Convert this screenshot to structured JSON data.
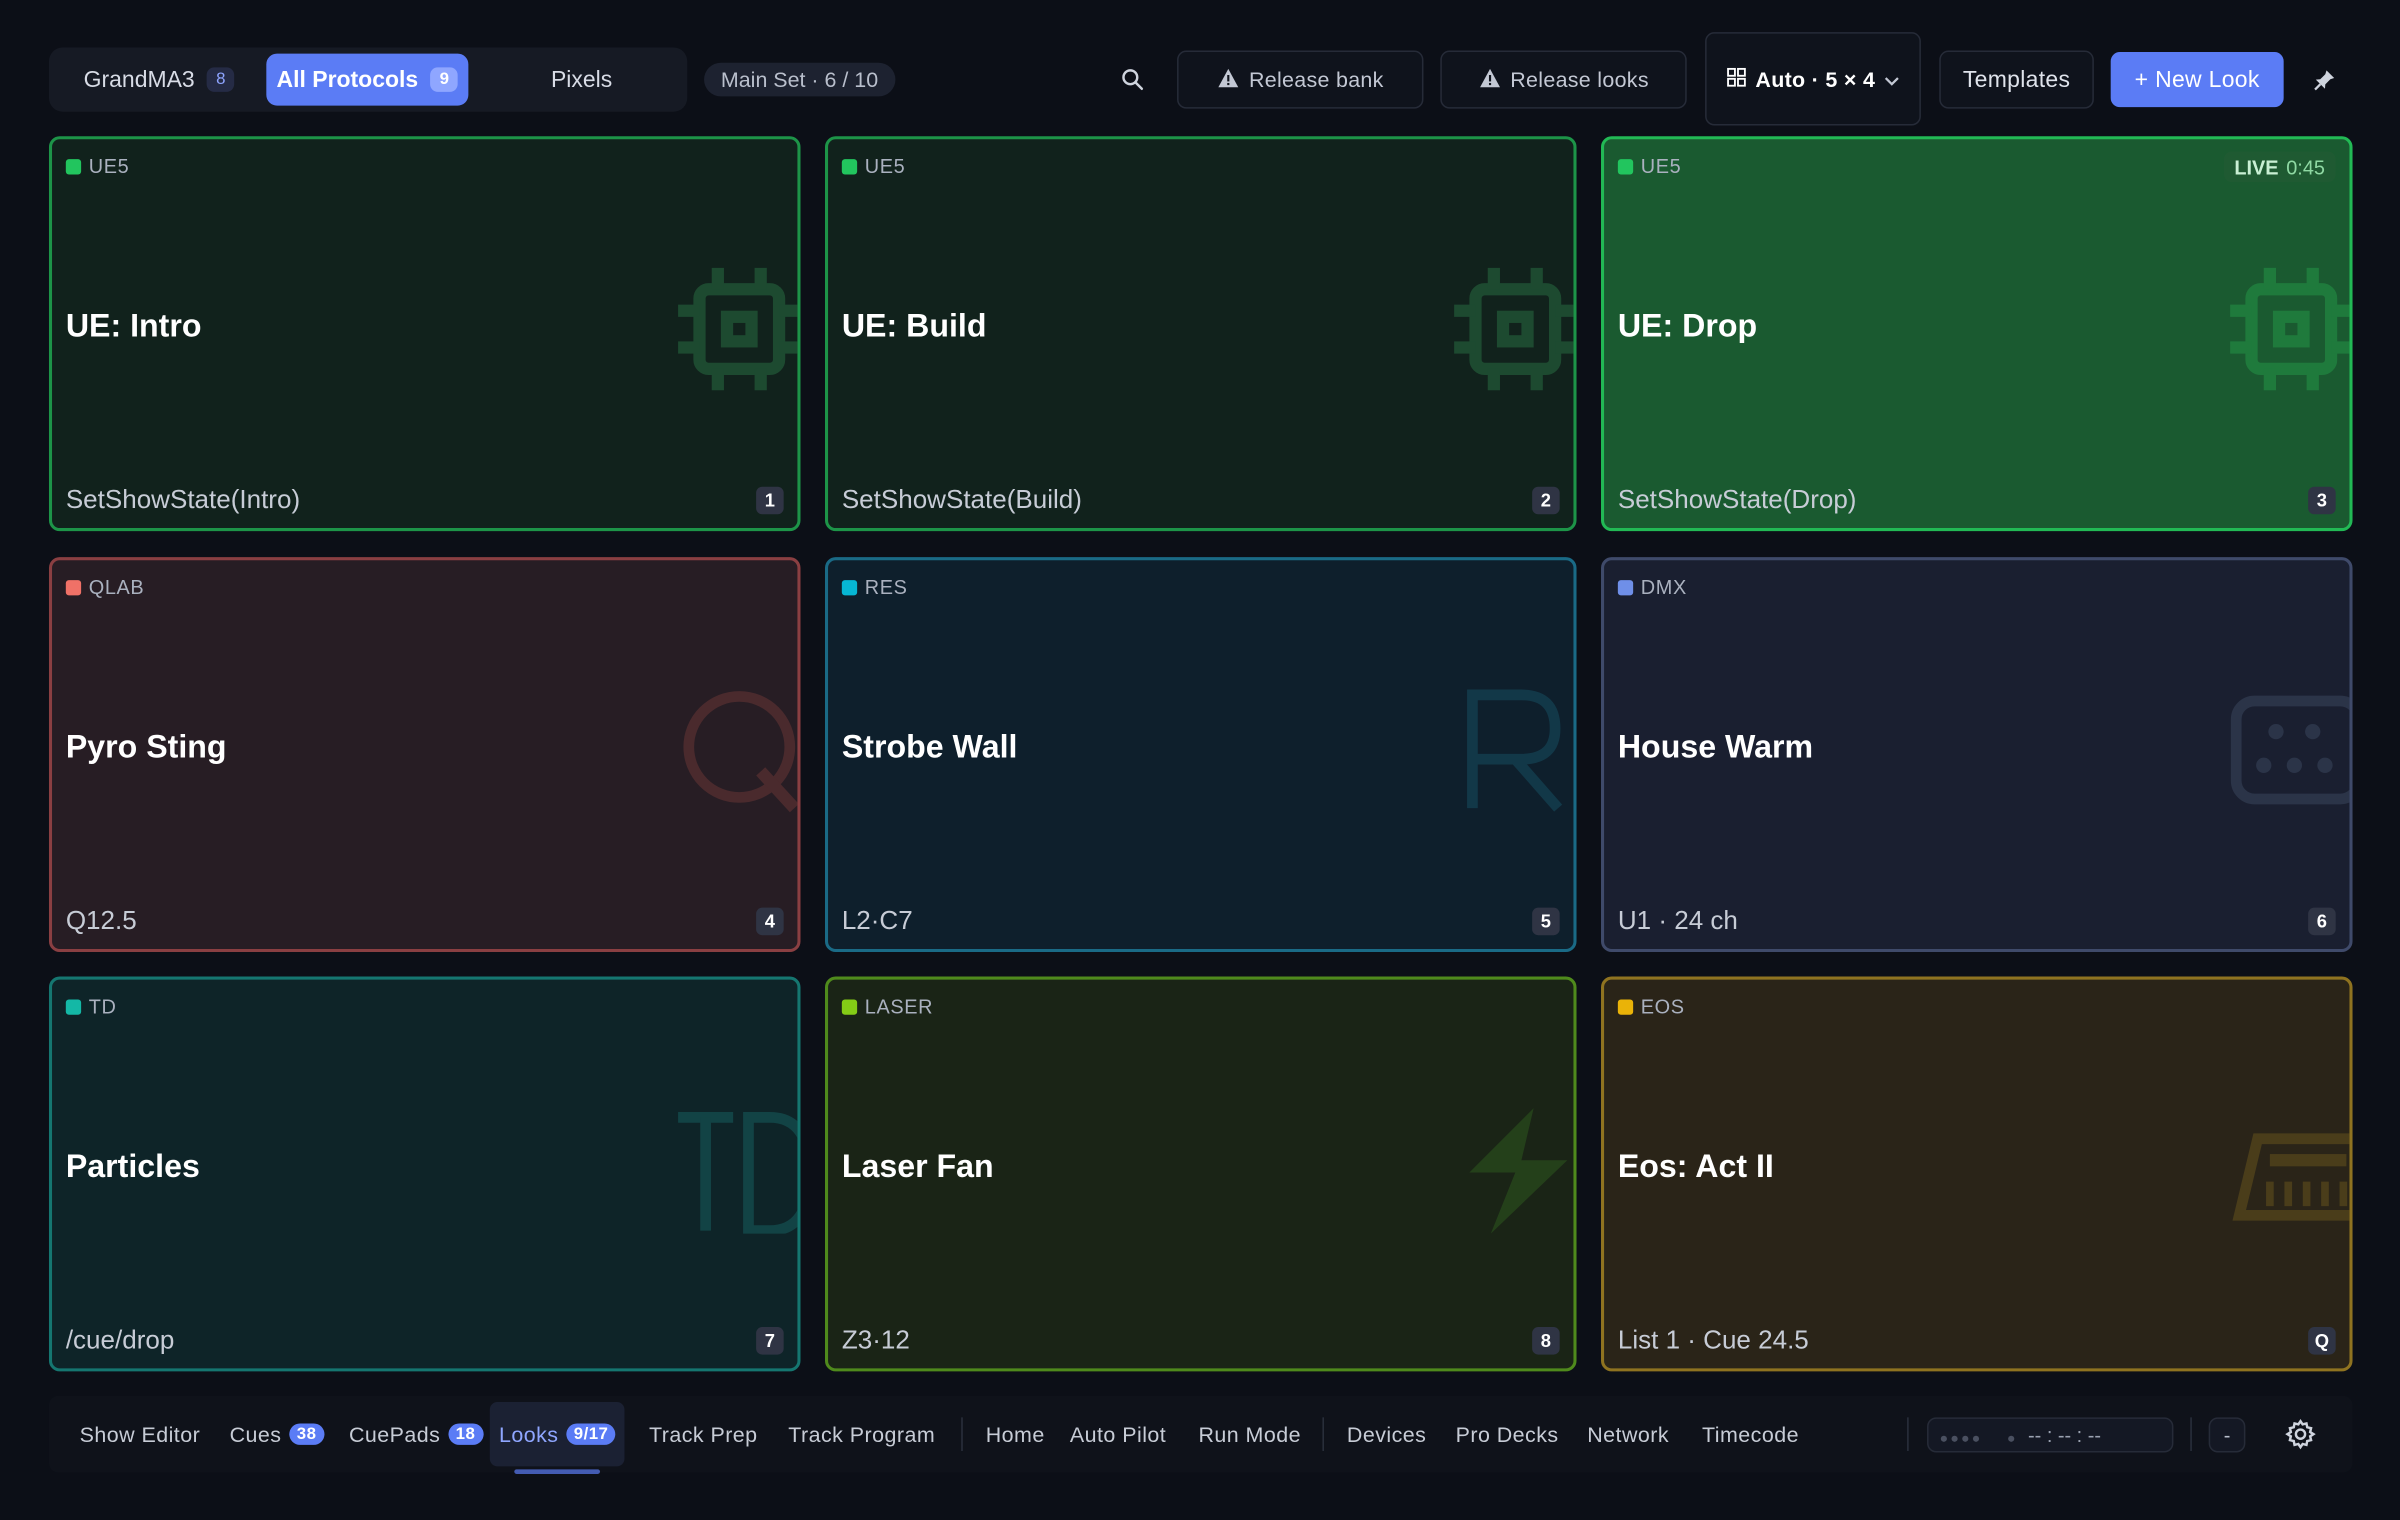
{
  "protocol_tabs": [
    {
      "label": "GrandMA3",
      "count": "8"
    },
    {
      "label": "All Protocols",
      "count": "9"
    },
    {
      "label": "Pixels",
      "count": ""
    }
  ],
  "main_set": "Main Set · 6 / 10",
  "toolbar": {
    "release_bank": "Release bank",
    "release_looks": "Release looks",
    "grid_mode": "Auto · 5 × 4",
    "templates": "Templates",
    "new_look": "+ New Look"
  },
  "cards": [
    {
      "protocol": "UE5",
      "title": "UE: Intro",
      "sub": "SetShowState(Intro)",
      "key": "1",
      "icon": "chip-icon",
      "live": false
    },
    {
      "protocol": "UE5",
      "title": "UE: Build",
      "sub": "SetShowState(Build)",
      "key": "2",
      "icon": "chip-icon",
      "live": false
    },
    {
      "protocol": "UE5",
      "title": "UE: Drop",
      "sub": "SetShowState(Drop)",
      "key": "3",
      "icon": "chip-icon",
      "live": true,
      "live_label": "LIVE",
      "live_time": "0:45"
    },
    {
      "protocol": "QLAB",
      "title": "Pyro Sting",
      "sub": "Q12.5",
      "key": "4",
      "icon": "q-letter-icon",
      "live": false
    },
    {
      "protocol": "RES",
      "title": "Strobe Wall",
      "sub": "L2·C7",
      "key": "5",
      "icon": "r-letter-icon",
      "live": false
    },
    {
      "protocol": "DMX",
      "title": "House Warm",
      "sub": "U1 · 24 ch",
      "key": "6",
      "icon": "dmx-connector-icon",
      "live": false
    },
    {
      "protocol": "TD",
      "title": "Particles",
      "sub": "/cue/drop",
      "key": "7",
      "icon": "td-letters-icon",
      "live": false
    },
    {
      "protocol": "LASER",
      "title": "Laser Fan",
      "sub": "Z3·12",
      "key": "8",
      "icon": "lightning-icon",
      "live": false
    },
    {
      "protocol": "EOS",
      "title": "Eos: Act II",
      "sub": "List 1 · Cue 24.5",
      "key": "Q",
      "icon": "console-icon",
      "live": false
    }
  ],
  "colors": {
    "accent": "#5b7cf5",
    "ue5": "#22c55e",
    "qlab": "#f07167",
    "res": "#06b6d4",
    "dmx": "#6f8fe8",
    "td": "#14b8a6",
    "laser": "#84cc16",
    "eos": "#eab308"
  },
  "bottom_nav": [
    {
      "label": "Show Editor",
      "count": ""
    },
    {
      "label": "Cues",
      "count": "38"
    },
    {
      "label": "CuePads",
      "count": "18"
    },
    {
      "label": "Looks",
      "count": "9/17"
    },
    {
      "label": "Track Prep",
      "count": ""
    },
    {
      "label": "Track Program",
      "count": ""
    },
    {
      "label": "Home",
      "count": ""
    },
    {
      "label": "Auto Pilot",
      "count": ""
    },
    {
      "label": "Run Mode",
      "count": ""
    },
    {
      "label": "Devices",
      "count": ""
    },
    {
      "label": "Pro Decks",
      "count": ""
    },
    {
      "label": "Network",
      "count": ""
    },
    {
      "label": "Timecode",
      "count": ""
    }
  ],
  "timecode": "-- : -- : --",
  "minus_label": "-"
}
